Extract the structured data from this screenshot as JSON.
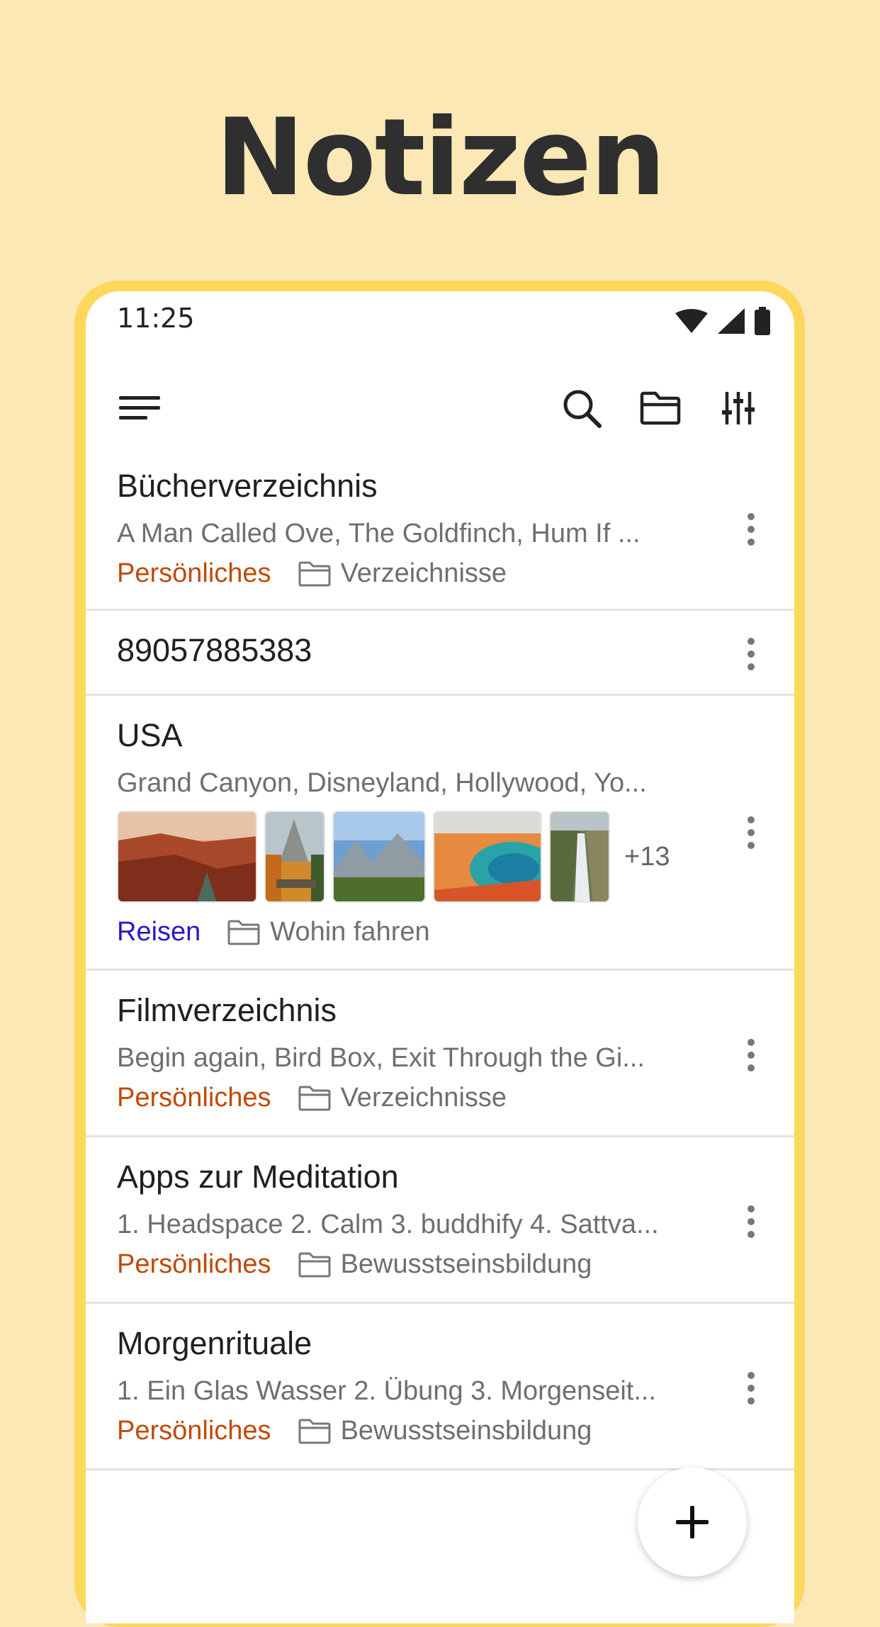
{
  "headline": "Notizen",
  "status_bar": {
    "time": "11:25",
    "icons": [
      "wifi-icon",
      "cellular-signal-icon",
      "battery-icon"
    ]
  },
  "toolbar": {
    "icons": [
      "menu-icon",
      "search-icon",
      "folder-icon",
      "filter-sliders-icon"
    ]
  },
  "notes": [
    {
      "title": "Bücherverzeichnis",
      "preview": "A Man Called Ove, The Goldfinch, Hum If ...",
      "label": "Persönliches",
      "folder": "Verzeichnisse"
    },
    {
      "title": "89057885383"
    },
    {
      "title": "USA",
      "preview": "Grand Canyon, Disneyland, Hollywood, Yo...",
      "thumbnails": [
        "canyon",
        "yosemite-autumn",
        "yosemite-valley",
        "hot-spring",
        "waterfall"
      ],
      "more_images": "+13",
      "label": "Reisen",
      "folder": "Wohin fahren"
    },
    {
      "title": "Filmverzeichnis",
      "preview": "Begin again, Bird Box, Exit Through the Gi...",
      "label": "Persönliches",
      "folder": "Verzeichnisse"
    },
    {
      "title": "Apps zur Meditation",
      "preview": "1. Headspace 2. Calm 3. buddhify 4. Sattva...",
      "label": "Persönliches",
      "folder": "Bewusstseinsbildung"
    },
    {
      "title": "Morgenrituale",
      "preview": "1. Ein Glas Wasser 2. Übung 3. Morgenseit...",
      "label": "Persönliches",
      "folder": "Bewusstseinsbildung"
    }
  ],
  "colors": {
    "background": "#fce8b4",
    "frame": "#fed75b",
    "label_personal": "#c04a06",
    "label_travel": "#2a18c8"
  }
}
